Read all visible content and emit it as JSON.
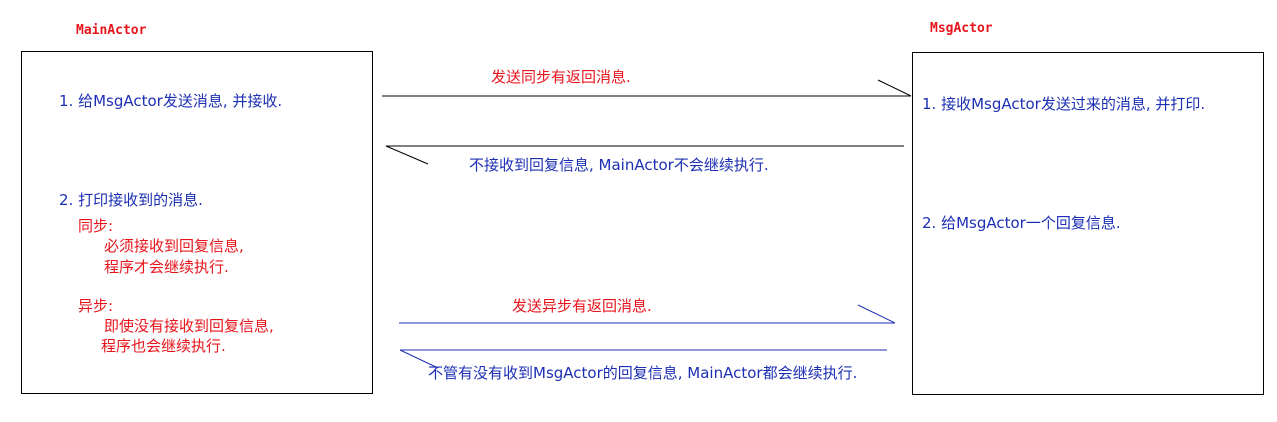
{
  "main_actor": {
    "title": "MainActor",
    "step1": "1. 给MsgActor发送消息, 并接收.",
    "step2": "2. 打印接收到的消息.",
    "sync_label": "同步:",
    "sync_line1": "必须接收到回复信息,",
    "sync_line2": "程序才会继续执行.",
    "async_label": "异步:",
    "async_line1": "即使没有接收到回复信息,",
    "async_line2": "程序也会继续执行."
  },
  "msg_actor": {
    "title": "MsgActor",
    "step1": "1. 接收MsgActor发送过来的消息, 并打印.",
    "step2": "2. 给MsgActor一个回复信息."
  },
  "messages": {
    "sync_send": "发送同步有返回消息.",
    "sync_reply": "不接收到回复信息, MainActor不会继续执行.",
    "async_send": "发送异步有返回消息.",
    "async_reply": "不管有没有收到MsgActor的回复信息, MainActor都会继续执行."
  }
}
